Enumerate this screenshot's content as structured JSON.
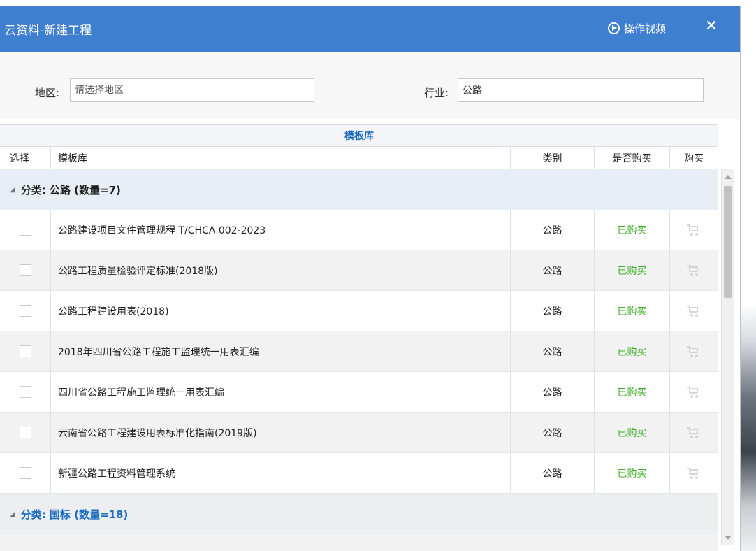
{
  "window": {
    "title": "云资料-新建工程",
    "video_label": "操作视频",
    "close_glyph": "✕",
    "accent_color": "#3f7fcf"
  },
  "filters": {
    "region_label": "地区:",
    "region_placeholder": "请选择地区",
    "industry_label": "行业:",
    "industry_value": "公路"
  },
  "grid": {
    "caption": "模板库",
    "columns": {
      "select": "选择",
      "name": "模板库",
      "category": "类别",
      "purchased": "是否购买",
      "buy": "购买"
    },
    "groups": [
      {
        "label": "分类: 公路 (数量=7)",
        "expanded": true,
        "rows": [
          {
            "name": "公路建设项目文件管理规程 T/CHCA 002-2023",
            "category": "公路",
            "purchased": "已购买"
          },
          {
            "name": "公路工程质量检验评定标准(2018版)",
            "category": "公路",
            "purchased": "已购买"
          },
          {
            "name": "公路工程建设用表(2018)",
            "category": "公路",
            "purchased": "已购买"
          },
          {
            "name": "2018年四川省公路工程施工监理统一用表汇编",
            "category": "公路",
            "purchased": "已购买"
          },
          {
            "name": "四川省公路工程施工监理统一用表汇编",
            "category": "公路",
            "purchased": "已购买"
          },
          {
            "name": "云南省公路工程建设用表标准化指南(2019版)",
            "category": "公路",
            "purchased": "已购买"
          },
          {
            "name": "新疆公路工程资料管理系统",
            "category": "公路",
            "purchased": "已购买"
          }
        ]
      },
      {
        "label": "分类: 国标 (数量=18)",
        "expanded": true,
        "rows": []
      }
    ],
    "purchased_color": "#3fae2a"
  },
  "icons": {
    "video": "play-circle-icon",
    "close": "close-icon",
    "buy": "cart-icon",
    "group_toggle": "expand-triangle-icon"
  }
}
